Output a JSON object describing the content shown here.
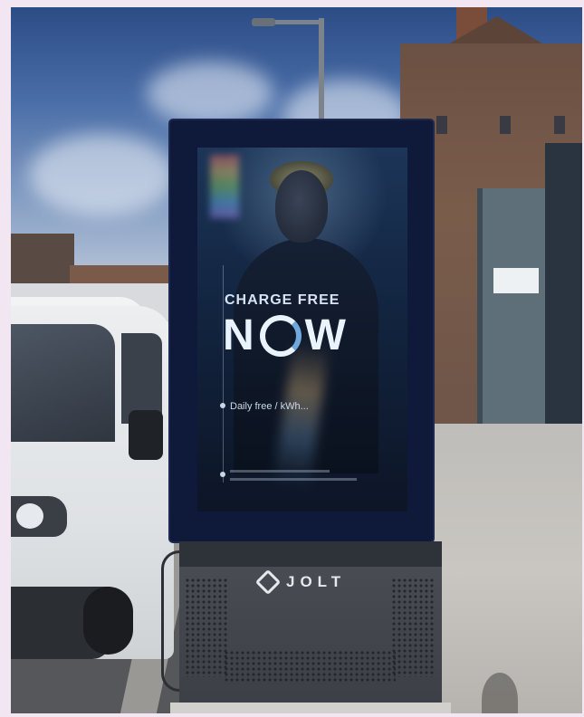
{
  "photo": {
    "description_icons": [
      "street-scene",
      "ev-charger-kiosk",
      "white-van",
      "brick-building",
      "street-lamp"
    ],
    "colors": {
      "frame": "#f1e6f1",
      "kiosk": "#0f1a3a",
      "base": "#3c3f45",
      "screen_text": "#eaf2fb"
    }
  },
  "screen": {
    "headline_line1": "CHARGE FREE",
    "headline_now_left": "N",
    "headline_now_right": "W",
    "tagline": "Daily free / kWh..."
  },
  "kiosk": {
    "brand": "JOLT"
  }
}
